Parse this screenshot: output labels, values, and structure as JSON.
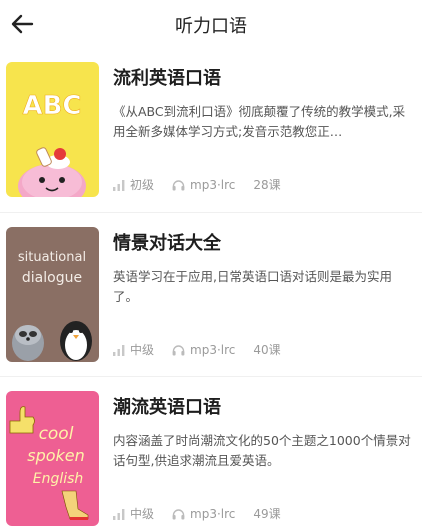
{
  "header": {
    "title": "听力口语"
  },
  "icons": {
    "back": "arrow-left-icon",
    "level": "signal-bars-icon",
    "audio": "headphones-icon"
  },
  "courses": [
    {
      "title": "流利英语口语",
      "description": "《从ABC到流利口语》彻底颠覆了传统的教学模式,采用全新多媒体学习方式;发音示范教您正…",
      "level": "初级",
      "format": "mp3·lrc",
      "lessons": "28课",
      "cover_text": "ABC",
      "cover_color": "#f7e44d"
    },
    {
      "title": "情景对话大全",
      "description": "英语学习在于应用,日常英语口语对话则是最为实用了。",
      "level": "中级",
      "format": "mp3·lrc",
      "lessons": "40课",
      "cover_text": [
        "situational",
        "dialogue"
      ],
      "cover_color": "#8a6f64"
    },
    {
      "title": "潮流英语口语",
      "description": "内容涵盖了时尚潮流文化的50个主题之1000个情景对话句型,供追求潮流且爱英语。",
      "level": "中级",
      "format": "mp3·lrc",
      "lessons": "49课",
      "cover_text": [
        "cool",
        "spoken",
        "English"
      ],
      "cover_color": "#ee5f93"
    }
  ]
}
